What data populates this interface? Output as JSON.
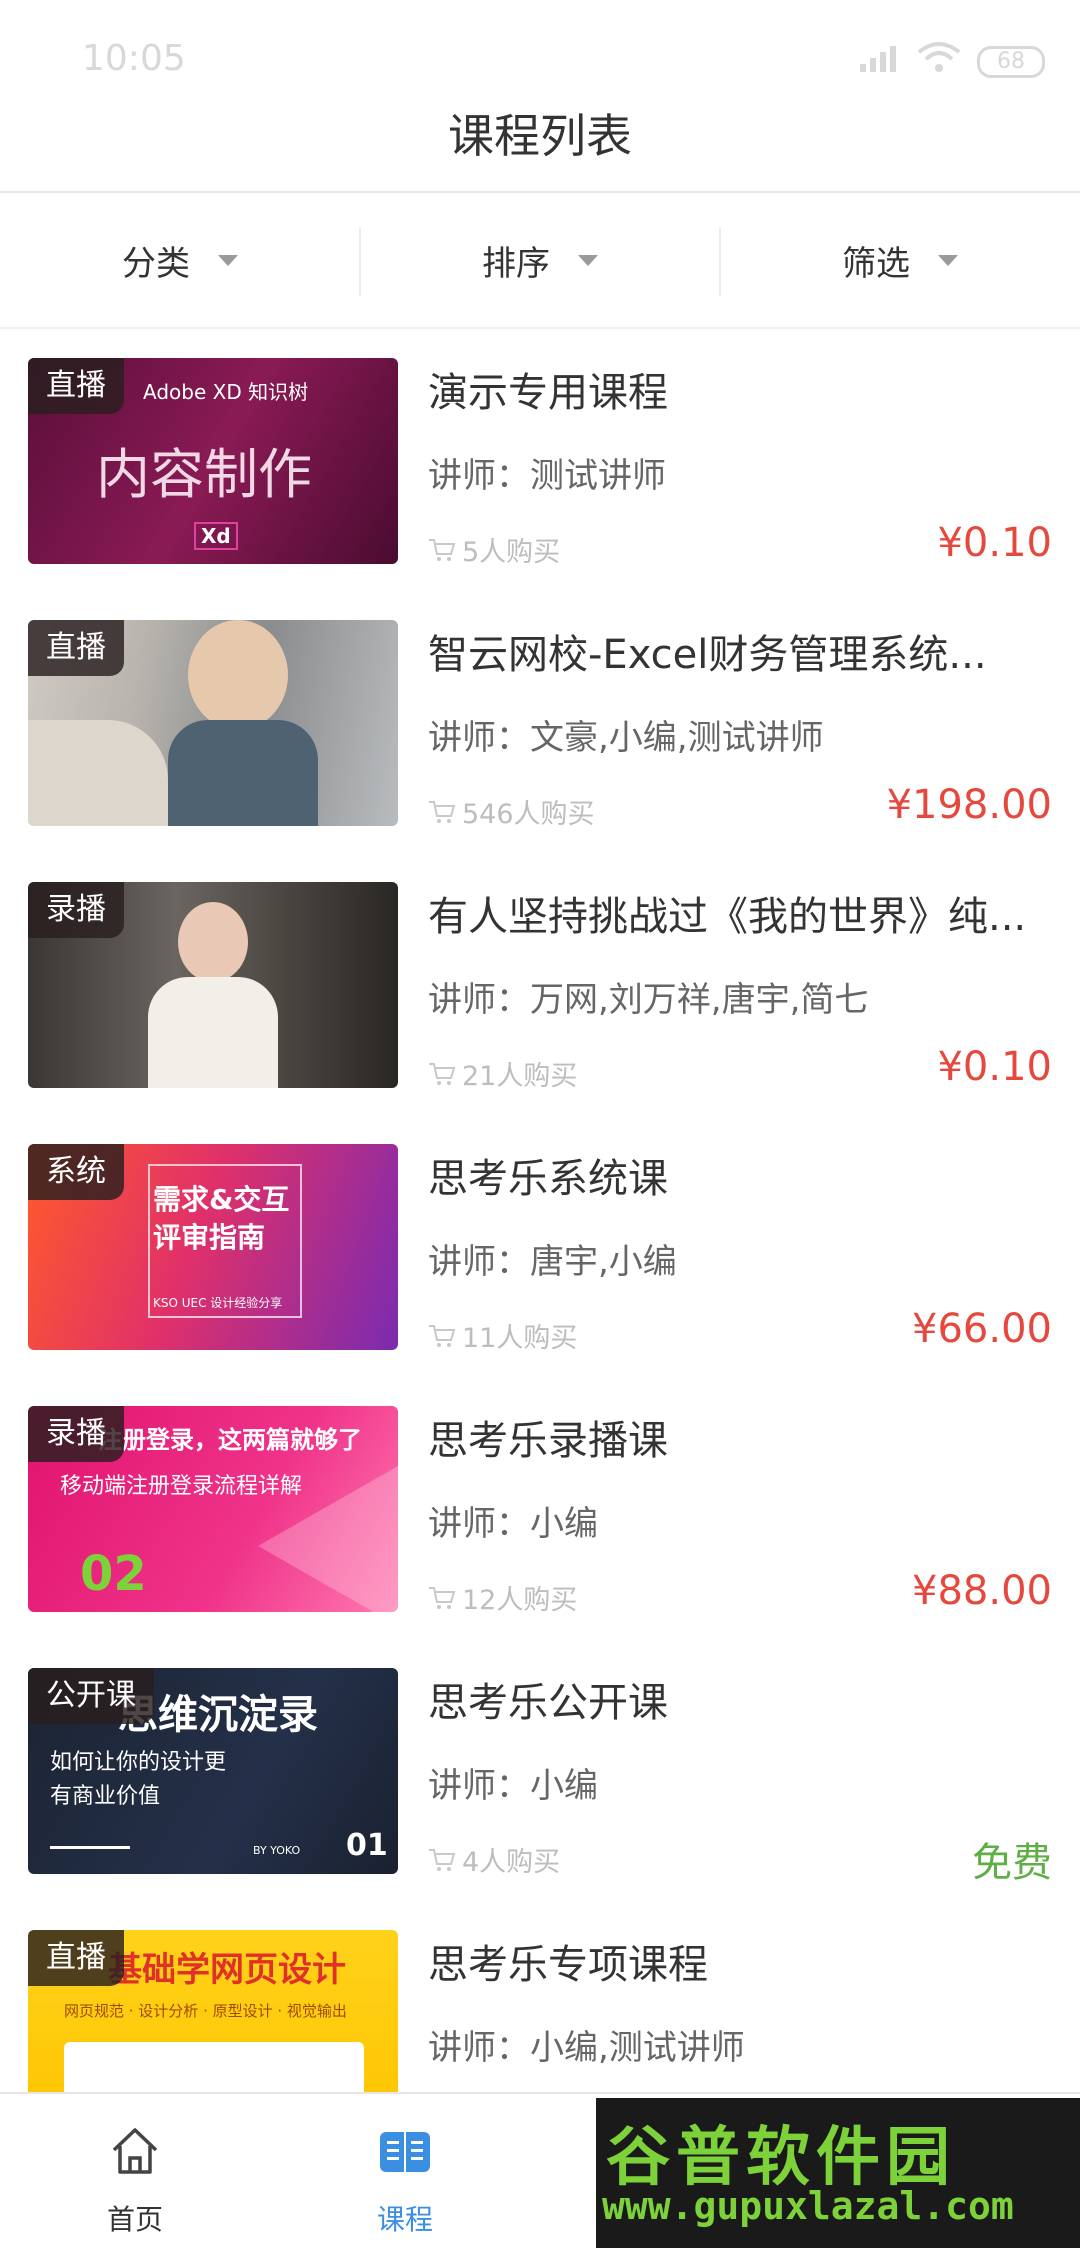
{
  "status_bar": {
    "time": "10:05",
    "battery": "68"
  },
  "page": {
    "title": "课程列表"
  },
  "filters": [
    {
      "label": "分类"
    },
    {
      "label": "排序"
    },
    {
      "label": "筛选"
    }
  ],
  "courses": [
    {
      "badge": "直播",
      "title": "演示专用课程",
      "lecturer": "讲师：测试讲师",
      "buyers": "5人购买",
      "price": "¥0.10",
      "thumb_lines": [
        "Adobe XD 知识树",
        "内容制作",
        "Xd"
      ]
    },
    {
      "badge": "直播",
      "title": "智云网校-Excel财务管理系统...",
      "lecturer": "讲师：文豪,小编,测试讲师",
      "buyers": "546人购买",
      "price": "¥198.00",
      "thumb_lines": []
    },
    {
      "badge": "录播",
      "title": "有人坚持挑战过《我的世界》纯...",
      "lecturer": "讲师：万网,刘万祥,唐宇,简七",
      "buyers": "21人购买",
      "price": "¥0.10",
      "thumb_lines": []
    },
    {
      "badge": "系统",
      "title": "思考乐系统课",
      "lecturer": "讲师：唐宇,小编",
      "buyers": "11人购买",
      "price": "¥66.00",
      "thumb_lines": [
        "需求&交互",
        "评审指南",
        "KSO UEC 设计经验分享"
      ]
    },
    {
      "badge": "录播",
      "title": "思考乐录播课",
      "lecturer": "讲师：小编",
      "buyers": "12人购买",
      "price": "¥88.00",
      "thumb_lines": [
        "注册登录，这两篇就够了",
        "移动端注册登录流程详解",
        "02"
      ]
    },
    {
      "badge": "公开课",
      "title": "思考乐公开课",
      "lecturer": "讲师：小编",
      "buyers": "4人购买",
      "price": "免费",
      "thumb_lines": [
        "思维沉淀录",
        "如何让你的设计更",
        "有商业价值",
        "BY YOKO",
        "01"
      ]
    },
    {
      "badge": "直播",
      "title": "思考乐专项课程",
      "lecturer": "讲师：小编,测试讲师",
      "buyers": "",
      "price": "",
      "thumb_lines": [
        "基础学网页设计",
        "网页规范 · 设计分析 · 原型设计 · 视觉输出"
      ]
    }
  ],
  "tabbar": [
    {
      "label": "首页",
      "icon": "home-icon"
    },
    {
      "label": "课程",
      "icon": "book-icon"
    }
  ],
  "watermark": {
    "main": "谷普软件园",
    "url": "www.gupuxlazal.com"
  },
  "colors": {
    "price": "#e6483e",
    "free": "#5fae46",
    "active_tab": "#3b8fe2"
  }
}
